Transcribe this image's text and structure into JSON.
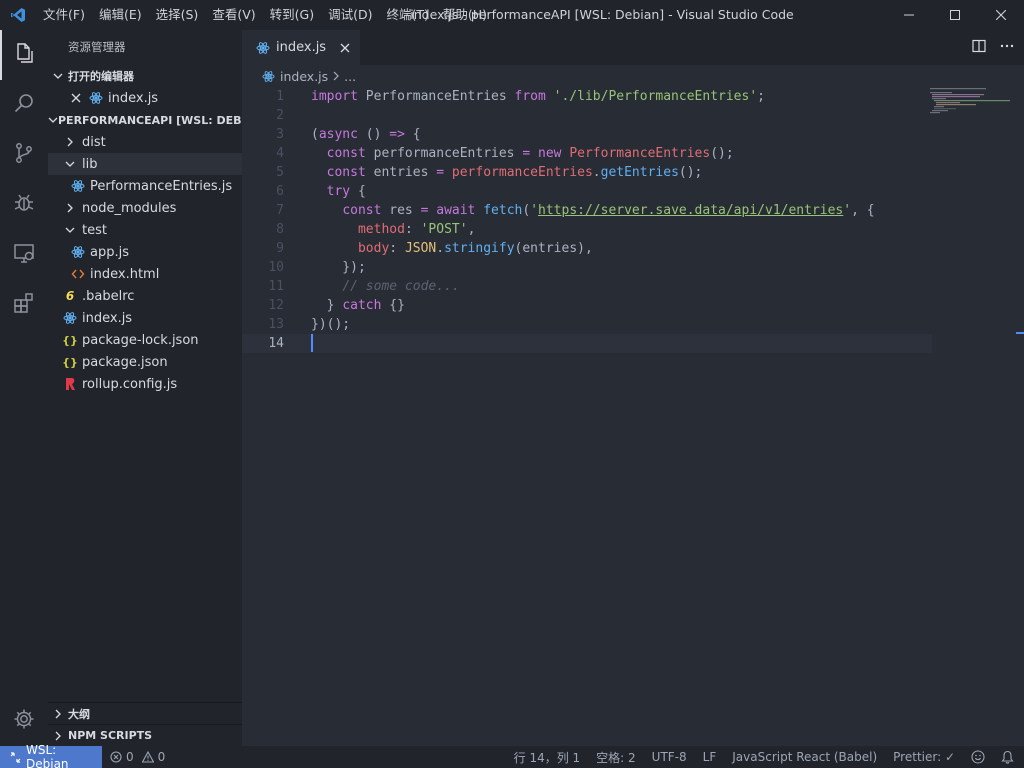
{
  "titlebar": {
    "menu": [
      "文件(F)",
      "编辑(E)",
      "选择(S)",
      "查看(V)",
      "转到(G)",
      "调试(D)",
      "终端(T)",
      "帮助(H)"
    ],
    "window_title": "index.js - performanceAPI [WSL: Debian] - Visual Studio Code"
  },
  "activitybar": {
    "items": [
      "files-icon",
      "search-icon",
      "source-control-icon",
      "debug-icon",
      "remote-explorer-icon",
      "extensions-icon"
    ],
    "bottom": "gear-icon"
  },
  "sidebar": {
    "title": "资源管理器",
    "open_editors": {
      "header": "打开的编辑器",
      "items": [
        {
          "label": "index.js"
        }
      ]
    },
    "workspace": {
      "header": "PERFORMANCEAPI [WSL: DEBI...",
      "items": [
        {
          "label": "dist",
          "kind": "folder",
          "depth": 0,
          "expanded": false
        },
        {
          "label": "lib",
          "kind": "folder",
          "depth": 0,
          "expanded": true
        },
        {
          "label": "PerformanceEntries.js",
          "kind": "react",
          "depth": 1
        },
        {
          "label": "node_modules",
          "kind": "folder",
          "depth": 0,
          "expanded": false
        },
        {
          "label": "test",
          "kind": "folder",
          "depth": 0,
          "expanded": true
        },
        {
          "label": "app.js",
          "kind": "react",
          "depth": 1
        },
        {
          "label": "index.html",
          "kind": "html",
          "depth": 1
        },
        {
          "label": ".babelrc",
          "kind": "babel",
          "depth": 0
        },
        {
          "label": "index.js",
          "kind": "react",
          "depth": 0
        },
        {
          "label": "package-lock.json",
          "kind": "json",
          "depth": 0
        },
        {
          "label": "package.json",
          "kind": "json",
          "depth": 0
        },
        {
          "label": "rollup.config.js",
          "kind": "rollup",
          "depth": 0
        }
      ]
    },
    "outline": "大纲",
    "npm_scripts": "NPM SCRIPTS"
  },
  "editor": {
    "tab": {
      "label": "index.js"
    },
    "breadcrumb": {
      "file": "index.js",
      "more": "..."
    },
    "lines": [
      [
        [
          "kw",
          "import"
        ],
        [
          "pl",
          " PerformanceEntries "
        ],
        [
          "kw",
          "from"
        ],
        [
          "pl",
          " "
        ],
        [
          "str",
          "'./lib/PerformanceEntries'"
        ],
        [
          "pl",
          ";"
        ]
      ],
      [],
      [
        [
          "pl",
          "("
        ],
        [
          "kw",
          "async"
        ],
        [
          "pl",
          " () "
        ],
        [
          "kw",
          "=>"
        ],
        [
          "pl",
          " {"
        ]
      ],
      [
        [
          "pl",
          "  "
        ],
        [
          "kw",
          "const"
        ],
        [
          "pl",
          " performanceEntries "
        ],
        [
          "kw",
          "="
        ],
        [
          "pl",
          " "
        ],
        [
          "kw",
          "new"
        ],
        [
          "pl",
          " "
        ],
        [
          "var",
          "PerformanceEntries"
        ],
        [
          "pl",
          "();"
        ]
      ],
      [
        [
          "pl",
          "  "
        ],
        [
          "kw",
          "const"
        ],
        [
          "pl",
          " entries "
        ],
        [
          "kw",
          "="
        ],
        [
          "pl",
          " "
        ],
        [
          "var",
          "performanceEntries"
        ],
        [
          "pl",
          "."
        ],
        [
          "fn",
          "getEntries"
        ],
        [
          "pl",
          "();"
        ]
      ],
      [
        [
          "pl",
          "  "
        ],
        [
          "kw",
          "try"
        ],
        [
          "pl",
          " {"
        ]
      ],
      [
        [
          "pl",
          "    "
        ],
        [
          "kw",
          "const"
        ],
        [
          "pl",
          " res "
        ],
        [
          "kw",
          "="
        ],
        [
          "pl",
          " "
        ],
        [
          "kw",
          "await"
        ],
        [
          "pl",
          " "
        ],
        [
          "fn",
          "fetch"
        ],
        [
          "pl",
          "("
        ],
        [
          "str",
          "'"
        ],
        [
          "url",
          "https://server.save.data/api/v1/entries"
        ],
        [
          "str",
          "'"
        ],
        [
          "pl",
          ", {"
        ]
      ],
      [
        [
          "pl",
          "      "
        ],
        [
          "prop",
          "method"
        ],
        [
          "pl",
          ": "
        ],
        [
          "str",
          "'POST'"
        ],
        [
          "pl",
          ","
        ]
      ],
      [
        [
          "pl",
          "      "
        ],
        [
          "prop",
          "body"
        ],
        [
          "pl",
          ": "
        ],
        [
          "cls",
          "JSON"
        ],
        [
          "pl",
          "."
        ],
        [
          "fn",
          "stringify"
        ],
        [
          "pl",
          "(entries),"
        ]
      ],
      [
        [
          "pl",
          "    });"
        ]
      ],
      [
        [
          "pl",
          "    "
        ],
        [
          "cm",
          "// some code..."
        ]
      ],
      [
        [
          "pl",
          "  } "
        ],
        [
          "kw",
          "catch"
        ],
        [
          "pl",
          " {}"
        ]
      ],
      [
        [
          "pl",
          "})();"
        ]
      ],
      []
    ],
    "current_line": 14
  },
  "statusbar": {
    "remote": "WSL: Debian",
    "errors": "0",
    "warnings": "0",
    "position": "行 14，列 1",
    "spaces": "空格: 2",
    "encoding": "UTF-8",
    "eol": "LF",
    "language": "JavaScript React (Babel)",
    "prettier": "Prettier: ✓"
  }
}
